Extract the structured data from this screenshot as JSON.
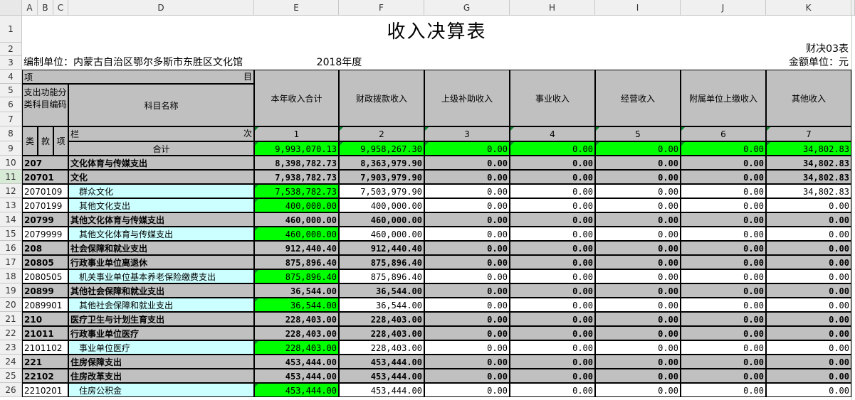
{
  "columns": [
    "A",
    "B",
    "C",
    "D",
    "E",
    "F",
    "G",
    "H",
    "I",
    "J",
    "K"
  ],
  "rows": [
    "1",
    "2",
    "3",
    "4",
    "5",
    "6",
    "7",
    "8",
    "9",
    "10",
    "11",
    "12",
    "13",
    "14",
    "15",
    "16",
    "17",
    "18",
    "19",
    "20",
    "21",
    "22",
    "23",
    "24",
    "25",
    "26"
  ],
  "title": "收入决算表",
  "form_no": "财决03表",
  "unit": "编制单位：内蒙古自治区鄂尔多斯市东胜区文化馆",
  "year": "2018年度",
  "amount_unit": "金额单位：元",
  "header": {
    "xiang": "项",
    "mu": "目",
    "code_label": "支出功能分类科目编码",
    "subject_name": "科目名称",
    "lan": "栏",
    "ci": "次",
    "lei": "类",
    "kuan": "款",
    "xiang2": "项",
    "total_label": "合计",
    "col_titles": [
      "本年收入合计",
      "财政拨款收入",
      "上级补助收入",
      "事业收入",
      "经营收入",
      "附属单位上缴收入",
      "其他收入"
    ],
    "col_numbers": [
      "1",
      "2",
      "3",
      "4",
      "5",
      "6",
      "7"
    ]
  },
  "totals": [
    "9,993,070.13",
    "9,958,267.30",
    "0.00",
    "0.00",
    "0.00",
    "0.00",
    "34,802.83"
  ],
  "data_rows": [
    {
      "code": "207",
      "name": "文化体育与传媒支出",
      "level": "class",
      "values": [
        "8,398,782.73",
        "8,363,979.90",
        "0.00",
        "0.00",
        "0.00",
        "0.00",
        "34,802.83"
      ]
    },
    {
      "code": "20701",
      "name": "文化",
      "level": "class",
      "values": [
        "7,938,782.73",
        "7,903,979.90",
        "0.00",
        "0.00",
        "0.00",
        "0.00",
        "34,802.83"
      ]
    },
    {
      "code": "2070109",
      "name": "群众文化",
      "level": "item",
      "values": [
        "7,538,782.73",
        "7,503,979.90",
        "0.00",
        "0.00",
        "0.00",
        "0.00",
        "34,802.83"
      ]
    },
    {
      "code": "2070199",
      "name": "其他文化支出",
      "level": "item",
      "values": [
        "400,000.00",
        "400,000.00",
        "0.00",
        "0.00",
        "0.00",
        "0.00",
        "0.00"
      ]
    },
    {
      "code": "20799",
      "name": "其他文化体育与传媒支出",
      "level": "class",
      "values": [
        "460,000.00",
        "460,000.00",
        "0.00",
        "0.00",
        "0.00",
        "0.00",
        "0.00"
      ]
    },
    {
      "code": "2079999",
      "name": "其他文化体育与传媒支出",
      "level": "item",
      "values": [
        "460,000.00",
        "460,000.00",
        "0.00",
        "0.00",
        "0.00",
        "0.00",
        "0.00"
      ]
    },
    {
      "code": "208",
      "name": "社会保障和就业支出",
      "level": "class",
      "values": [
        "912,440.40",
        "912,440.40",
        "0.00",
        "0.00",
        "0.00",
        "0.00",
        "0.00"
      ]
    },
    {
      "code": "20805",
      "name": "行政事业单位离退休",
      "level": "class",
      "values": [
        "875,896.40",
        "875,896.40",
        "0.00",
        "0.00",
        "0.00",
        "0.00",
        "0.00"
      ]
    },
    {
      "code": "2080505",
      "name": "机关事业单位基本养老保险缴费支出",
      "level": "item",
      "values": [
        "875,896.40",
        "875,896.40",
        "0.00",
        "0.00",
        "0.00",
        "0.00",
        "0.00"
      ]
    },
    {
      "code": "20899",
      "name": "其他社会保障和就业支出",
      "level": "class",
      "values": [
        "36,544.00",
        "36,544.00",
        "0.00",
        "0.00",
        "0.00",
        "0.00",
        "0.00"
      ]
    },
    {
      "code": "2089901",
      "name": "其他社会保障和就业支出",
      "level": "item",
      "values": [
        "36,544.00",
        "36,544.00",
        "0.00",
        "0.00",
        "0.00",
        "0.00",
        "0.00"
      ]
    },
    {
      "code": "210",
      "name": "医疗卫生与计划生育支出",
      "level": "class",
      "values": [
        "228,403.00",
        "228,403.00",
        "0.00",
        "0.00",
        "0.00",
        "0.00",
        "0.00"
      ]
    },
    {
      "code": "21011",
      "name": "行政事业单位医疗",
      "level": "class",
      "values": [
        "228,403.00",
        "228,403.00",
        "0.00",
        "0.00",
        "0.00",
        "0.00",
        "0.00"
      ]
    },
    {
      "code": "2101102",
      "name": "事业单位医疗",
      "level": "item",
      "values": [
        "228,403.00",
        "228,403.00",
        "0.00",
        "0.00",
        "0.00",
        "0.00",
        "0.00"
      ]
    },
    {
      "code": "221",
      "name": "住房保障支出",
      "level": "class",
      "values": [
        "453,444.00",
        "453,444.00",
        "0.00",
        "0.00",
        "0.00",
        "0.00",
        "0.00"
      ]
    },
    {
      "code": "22102",
      "name": "住房改革支出",
      "level": "class",
      "values": [
        "453,444.00",
        "453,444.00",
        "0.00",
        "0.00",
        "0.00",
        "0.00",
        "0.00"
      ]
    },
    {
      "code": "2210201",
      "name": "住房公积金",
      "level": "item",
      "values": [
        "453,444.00",
        "453,444.00",
        "0.00",
        "0.00",
        "0.00",
        "0.00",
        "0.00"
      ]
    }
  ]
}
